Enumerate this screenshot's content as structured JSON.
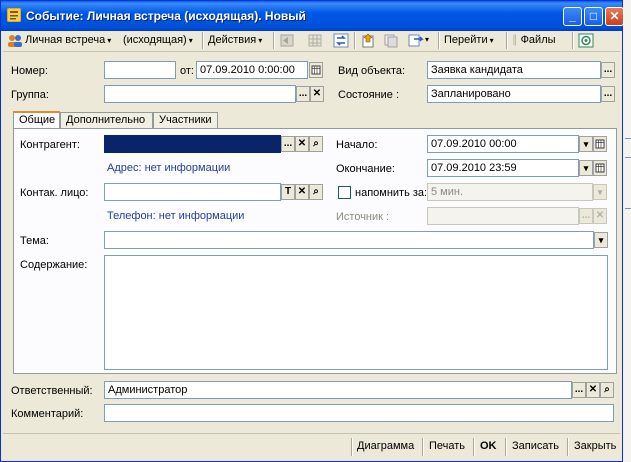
{
  "window": {
    "title": "Событие: Личная встреча (исходящая). Новый",
    "controls": {
      "minimize": "_",
      "maximize": "□",
      "close": "✕"
    }
  },
  "toolbar": {
    "kind_label": "Личная встреча",
    "direction_label": "(исходящая)",
    "actions_label": "Действия",
    "goto_label": "Перейти",
    "files_label": "Файлы",
    "dropdown_glyph": "▾"
  },
  "header": {
    "number_label": "Номер:",
    "number_value": "",
    "date_from_label": "от:",
    "date_value": "07.09.2010  0:00:00",
    "group_label": "Группа:",
    "group_value": "",
    "object_type_label": "Вид объекта:",
    "object_type_value": "Заявка кандидата",
    "state_label": "Состояние :",
    "state_value": "Запланировано"
  },
  "tabs": [
    {
      "label": "Общие"
    },
    {
      "label": "Дополнительно"
    },
    {
      "label": "Участники"
    }
  ],
  "general": {
    "contractor_label": "Контрагент:",
    "contractor_value": "",
    "address_text": "Адрес: нет информации",
    "contact_label": "Контак. лицо:",
    "contact_value": "",
    "phone_text": "Телефон: нет информации",
    "start_label": "Начало:",
    "start_value": "07.09.2010 00:00",
    "end_label": "Окончание:",
    "end_value": "07.09.2010 23:59",
    "remind_label": "напомнить за:",
    "remind_value": "5 мин.",
    "source_label": "Источник :",
    "source_value": "",
    "subject_label": "Тема:",
    "subject_value": "",
    "content_label": "Содержание:",
    "content_value": ""
  },
  "footer_fields": {
    "responsible_label": "Ответственный:",
    "responsible_value": "Администратор",
    "comment_label": "Комментарий:",
    "comment_value": ""
  },
  "bottom_buttons": {
    "diagram": "Диаграмма",
    "print": "Печать",
    "ok": "OK",
    "save": "Записать",
    "close": "Закрыть"
  },
  "glyphs": {
    "ellipsis": "...",
    "clear": "✕",
    "search": "⌕",
    "text": "T",
    "dropdown": "▾"
  },
  "colors": {
    "titlebar": "#0054e3",
    "focused_field": "#0a246a",
    "link_text": "#1f3f9f"
  }
}
